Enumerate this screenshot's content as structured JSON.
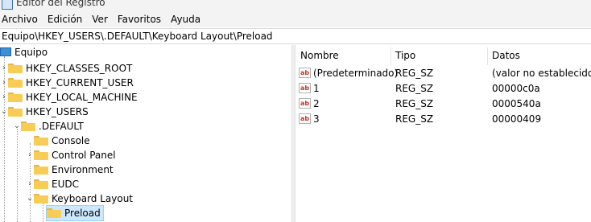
{
  "window": {
    "title": "Editor del Registro"
  },
  "menu": [
    "Archivo",
    "Edición",
    "Ver",
    "Favoritos",
    "Ayuda"
  ],
  "address": "Equipo\\HKEY_USERS\\.DEFAULT\\Keyboard Layout\\Preload",
  "tree": [
    {
      "label": "Equipo",
      "chevron": "",
      "icon": "computer-icon"
    },
    {
      "label": "HKEY_CLASSES_ROOT",
      "chevron": ">",
      "icon": "folder-icon"
    },
    {
      "label": "HKEY_CURRENT_USER",
      "chevron": ">",
      "icon": "folder-icon"
    },
    {
      "label": "HKEY_LOCAL_MACHINE",
      "chevron": ">",
      "icon": "folder-icon"
    },
    {
      "label": "HKEY_USERS",
      "chevron": "v",
      "icon": "folder-icon"
    },
    {
      "label": ".DEFAULT",
      "chevron": "v",
      "icon": "folder-icon"
    },
    {
      "label": "Console",
      "chevron": "",
      "icon": "folder-icon"
    },
    {
      "label": "Control Panel",
      "chevron": ">",
      "icon": "folder-icon"
    },
    {
      "label": "Environment",
      "chevron": "",
      "icon": "folder-icon"
    },
    {
      "label": "EUDC",
      "chevron": ">",
      "icon": "folder-icon"
    },
    {
      "label": "Keyboard Layout",
      "chevron": "v",
      "icon": "folder-icon"
    },
    {
      "label": "Preload",
      "chevron": "",
      "icon": "folder-open-icon",
      "selected": true
    }
  ],
  "list": {
    "columns": [
      "Nombre",
      "Tipo",
      "Datos"
    ],
    "rows": [
      {
        "name": "(Predeterminado)",
        "type": "REG_SZ",
        "data": "(valor no establecido)"
      },
      {
        "name": "1",
        "type": "REG_SZ",
        "data": "00000c0a"
      },
      {
        "name": "2",
        "type": "REG_SZ",
        "data": "0000540a"
      },
      {
        "name": "3",
        "type": "REG_SZ",
        "data": "00000409"
      }
    ]
  },
  "colors": {
    "selection": "#cce8ff",
    "folder": "#f8cd55",
    "string_icon": "#c0392b"
  }
}
